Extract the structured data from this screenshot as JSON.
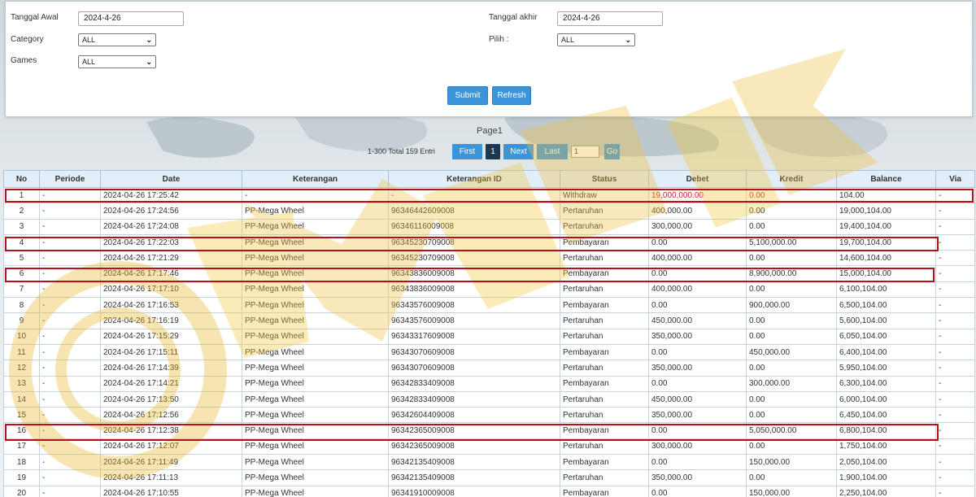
{
  "filters": {
    "start_date_label": "Tanggal Awal",
    "start_date_value": "2024-4-26",
    "end_date_label": "Tanggal akhir",
    "end_date_value": "2024-4-26",
    "category_label": "Category",
    "category_value": "ALL",
    "pilih_label": "Pilih :",
    "pilih_value": "ALL",
    "games_label": "Games",
    "games_value": "ALL",
    "submit_label": "Submit",
    "refresh_label": "Refresh"
  },
  "pagination": {
    "page_title": "Page1",
    "total_text": "1-300 Total 159 Entri",
    "first_label": "First",
    "current_page": "1",
    "next_label": "Next",
    "last_label": "Last",
    "page_input_value": "1",
    "go_label": "Go"
  },
  "table": {
    "headers": [
      "No",
      "Periode",
      "Date",
      "Keterangan",
      "Keterangan ID",
      "Status",
      "Debet",
      "Kredit",
      "Balance",
      "Via"
    ],
    "rows": [
      [
        "1",
        "-",
        "2024-04-26 17:25:42",
        "-",
        "-",
        "Withdraw",
        "19,000,000.00",
        "0.00",
        "104.00",
        "-"
      ],
      [
        "2",
        "-",
        "2024-04-26 17:24:56",
        "PP-Mega Wheel",
        "96346442609008",
        "Pertaruhan",
        "400,000.00",
        "0.00",
        "19,000,104.00",
        "-"
      ],
      [
        "3",
        "-",
        "2024-04-26 17:24:08",
        "PP-Mega Wheel",
        "96346116009008",
        "Pertaruhan",
        "300,000.00",
        "0.00",
        "19,400,104.00",
        "-"
      ],
      [
        "4",
        "-",
        "2024-04-26 17:22:03",
        "PP-Mega Wheel",
        "96345230709008",
        "Pembayaran",
        "0.00",
        "5,100,000.00",
        "19,700,104.00",
        "-"
      ],
      [
        "5",
        "-",
        "2024-04-26 17:21:29",
        "PP-Mega Wheel",
        "96345230709008",
        "Pertaruhan",
        "400,000.00",
        "0.00",
        "14,600,104.00",
        "-"
      ],
      [
        "6",
        "-",
        "2024-04-26 17:17:46",
        "PP-Mega Wheel",
        "96343836009008",
        "Pembayaran",
        "0.00",
        "8,900,000.00",
        "15,000,104.00",
        "-"
      ],
      [
        "7",
        "-",
        "2024-04-26 17:17:10",
        "PP-Mega Wheel",
        "96343836009008",
        "Pertaruhan",
        "400,000.00",
        "0.00",
        "6,100,104.00",
        "-"
      ],
      [
        "8",
        "-",
        "2024-04-26 17:16:53",
        "PP-Mega Wheel",
        "96343576009008",
        "Pembayaran",
        "0.00",
        "900,000.00",
        "6,500,104.00",
        "-"
      ],
      [
        "9",
        "-",
        "2024-04-26 17:16:19",
        "PP-Mega Wheel",
        "96343576009008",
        "Pertaruhan",
        "450,000.00",
        "0.00",
        "5,600,104.00",
        "-"
      ],
      [
        "10",
        "-",
        "2024-04-26 17:15:29",
        "PP-Mega Wheel",
        "96343317609008",
        "Pertaruhan",
        "350,000.00",
        "0.00",
        "6,050,104.00",
        "-"
      ],
      [
        "11",
        "-",
        "2024-04-26 17:15:11",
        "PP-Mega Wheel",
        "96343070609008",
        "Pembayaran",
        "0.00",
        "450,000.00",
        "6,400,104.00",
        "-"
      ],
      [
        "12",
        "-",
        "2024-04-26 17:14:39",
        "PP-Mega Wheel",
        "96343070609008",
        "Pertaruhan",
        "350,000.00",
        "0.00",
        "5,950,104.00",
        "-"
      ],
      [
        "13",
        "-",
        "2024-04-26 17:14:21",
        "PP-Mega Wheel",
        "96342833409008",
        "Pembayaran",
        "0.00",
        "300,000.00",
        "6,300,104.00",
        "-"
      ],
      [
        "14",
        "-",
        "2024-04-26 17:13:50",
        "PP-Mega Wheel",
        "96342833409008",
        "Pertaruhan",
        "450,000.00",
        "0.00",
        "6,000,104.00",
        "-"
      ],
      [
        "15",
        "-",
        "2024-04-26 17:12:56",
        "PP-Mega Wheel",
        "96342604409008",
        "Pertaruhan",
        "350,000.00",
        "0.00",
        "6,450,104.00",
        "-"
      ],
      [
        "16",
        "-",
        "2024-04-26 17:12:38",
        "PP-Mega Wheel",
        "96342365009008",
        "Pembayaran",
        "0.00",
        "5,050,000.00",
        "6,800,104.00",
        "-"
      ],
      [
        "17",
        "-",
        "2024-04-26 17:12:07",
        "PP-Mega Wheel",
        "96342365009008",
        "Pertaruhan",
        "300,000.00",
        "0.00",
        "1,750,104.00",
        "-"
      ],
      [
        "18",
        "-",
        "2024-04-26 17:11:49",
        "PP-Mega Wheel",
        "96342135409008",
        "Pembayaran",
        "0.00",
        "150,000.00",
        "2,050,104.00",
        "-"
      ],
      [
        "19",
        "-",
        "2024-04-26 17:11:13",
        "PP-Mega Wheel",
        "96342135409008",
        "Pertaruhan",
        "350,000.00",
        "0.00",
        "1,900,104.00",
        "-"
      ],
      [
        "20",
        "-",
        "2024-04-26 17:10:55",
        "PP-Mega Wheel",
        "96341910009008",
        "Pembayaran",
        "0.00",
        "150,000.00",
        "2,250,104.00",
        "-"
      ]
    ],
    "highlighted_rows": [
      1,
      4,
      6,
      16
    ],
    "red_text_row": 1
  },
  "colors": {
    "button_blue": "#3c95d8",
    "active_page": "#1c3752",
    "highlight_red": "#b3121c",
    "header_bg": "#e2eefa",
    "watermark_gold": "#f0c040"
  }
}
